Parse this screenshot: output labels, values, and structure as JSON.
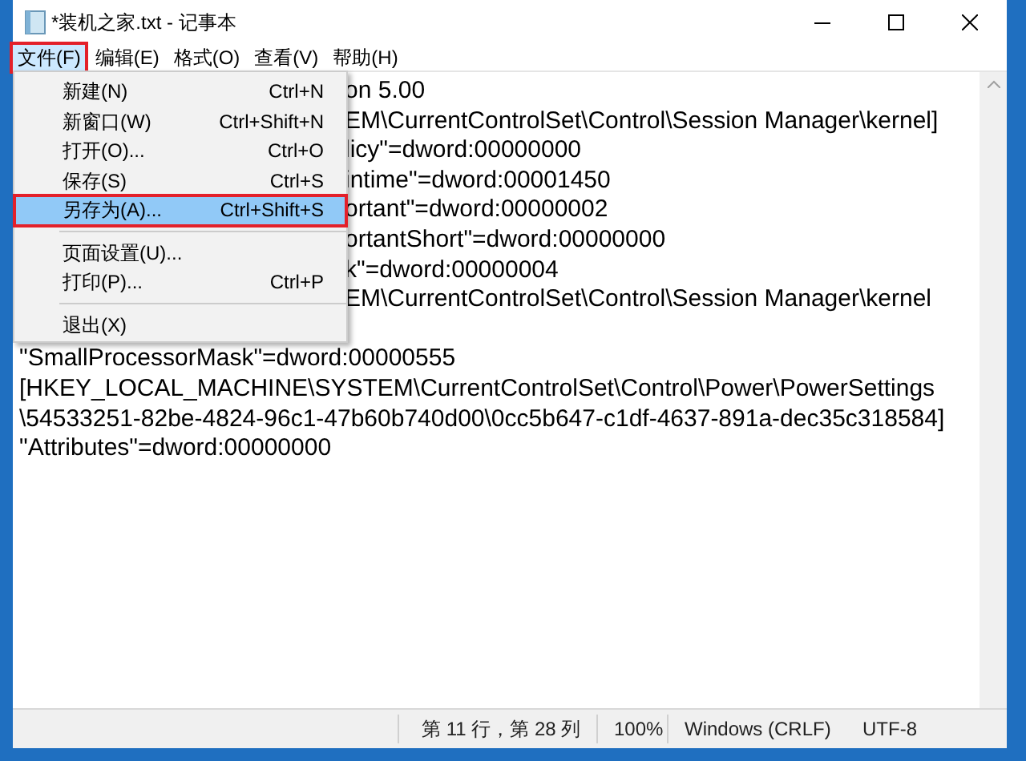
{
  "window": {
    "title": "*装机之家.txt - 记事本"
  },
  "menubar": [
    {
      "label": "文件(F)",
      "selected": true,
      "highlighted": true
    },
    {
      "label": "编辑(E)",
      "selected": false,
      "highlighted": false
    },
    {
      "label": "格式(O)",
      "selected": false,
      "highlighted": false
    },
    {
      "label": "查看(V)",
      "selected": false,
      "highlighted": false
    },
    {
      "label": "帮助(H)",
      "selected": false,
      "highlighted": false
    }
  ],
  "file_menu": [
    {
      "kind": "item",
      "label": "新建(N)",
      "shortcut": "Ctrl+N",
      "selected": false,
      "highlighted": false
    },
    {
      "kind": "item",
      "label": "新窗口(W)",
      "shortcut": "Ctrl+Shift+N",
      "selected": false,
      "highlighted": false
    },
    {
      "kind": "item",
      "label": "打开(O)...",
      "shortcut": "Ctrl+O",
      "selected": false,
      "highlighted": false
    },
    {
      "kind": "item",
      "label": "保存(S)",
      "shortcut": "Ctrl+S",
      "selected": false,
      "highlighted": false
    },
    {
      "kind": "item",
      "label": "另存为(A)...",
      "shortcut": "Ctrl+Shift+S",
      "selected": true,
      "highlighted": true
    },
    {
      "kind": "separator"
    },
    {
      "kind": "item",
      "label": "页面设置(U)...",
      "selected": false,
      "highlighted": false
    },
    {
      "kind": "item",
      "label": "打印(P)...",
      "shortcut": "Ctrl+P",
      "selected": false,
      "highlighted": false
    },
    {
      "kind": "separator"
    },
    {
      "kind": "item",
      "label": "退出(X)",
      "selected": false,
      "highlighted": false
    }
  ],
  "editor_lines": [
    {
      "kind": "clipped",
      "text": "on 5.00"
    },
    {
      "kind": "clipped",
      "text": "EM\\CurrentControlSet\\Control\\Session Manager\\kernel]"
    },
    {
      "kind": "clipped",
      "text": "licy\"=dword:00000000"
    },
    {
      "kind": "clipped",
      "text": "intime\"=dword:00001450"
    },
    {
      "kind": "clipped",
      "text": "ortant\"=dword:00000002"
    },
    {
      "kind": "clipped",
      "text": "ortantShort\"=dword:00000000"
    },
    {
      "kind": "clipped",
      "text": "k\"=dword:00000004"
    },
    {
      "kind": "clipped",
      "text": "EM\\CurrentControlSet\\Control\\Session Manager\\kernel"
    },
    {
      "kind": "hidden"
    },
    {
      "kind": "full",
      "text": "\"SmallProcessorMask\"=dword:00000555"
    },
    {
      "kind": "full",
      "text": "[HKEY_LOCAL_MACHINE\\SYSTEM\\CurrentControlSet\\Control\\Power\\PowerSettings"
    },
    {
      "kind": "full",
      "text": "\\54533251-82be-4824-96c1-47b60b740d00\\0cc5b647-c1df-4637-891a-dec35c318584]"
    },
    {
      "kind": "full",
      "text": "\"Attributes\"=dword:00000000"
    }
  ],
  "status_bar": {
    "position": "第 11 行，第 28 列",
    "zoom": "100%",
    "line_ending": "Windows (CRLF)",
    "encoding": "UTF-8"
  }
}
